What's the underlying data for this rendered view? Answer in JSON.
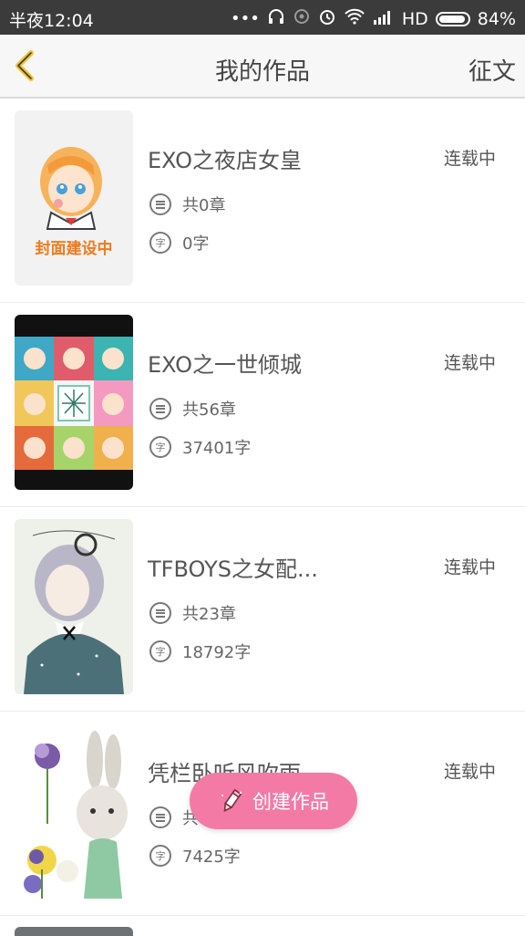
{
  "status_bar": {
    "time": "半夜12:04",
    "network": "HD",
    "battery": "84%",
    "battery_level": 0.84
  },
  "header": {
    "back_icon": "chevron-left-icon",
    "title": "我的作品",
    "action": "征文"
  },
  "works": [
    {
      "title": "EXO之夜店女皇",
      "status": "连载中",
      "chapters": "共0章",
      "words": "0字",
      "cover_text": "封面建设中"
    },
    {
      "title": "EXO之一世倾城",
      "status": "连载中",
      "chapters": "共56章",
      "words": "37401字"
    },
    {
      "title": "TFBOYS之女配...",
      "status": "连载中",
      "chapters": "共23章",
      "words": "18792字"
    },
    {
      "title": "凭栏卧听风吹雨",
      "status": "连载中",
      "chapters": "共",
      "words": "7425字"
    }
  ],
  "word_icon_label": "字",
  "fab": {
    "label": "创建作品",
    "icon": "pencil-icon"
  },
  "colors": {
    "accent_back": "#f2c230",
    "fab": "#f47aa6",
    "placeholder_text": "#f07a1c"
  }
}
